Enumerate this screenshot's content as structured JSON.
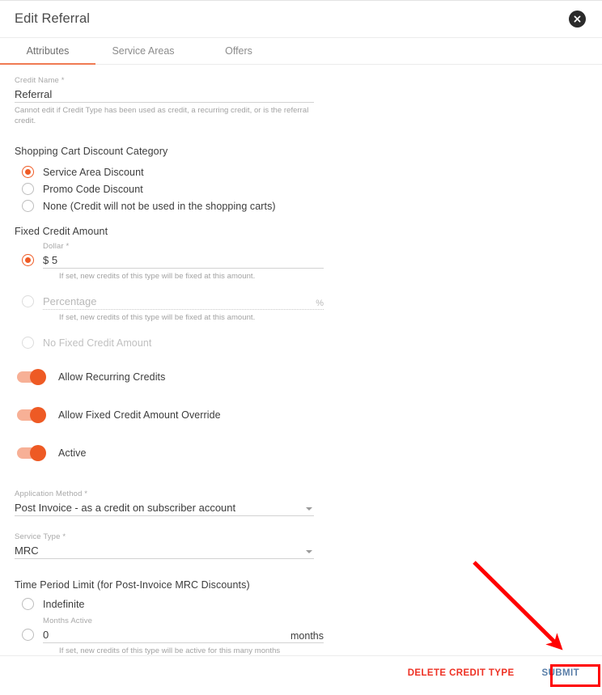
{
  "dialog": {
    "title": "Edit Referral",
    "close_icon": "close-circle-icon"
  },
  "tabs": [
    {
      "label": "Attributes",
      "active": true
    },
    {
      "label": "Service Areas",
      "active": false
    },
    {
      "label": "Offers",
      "active": false
    }
  ],
  "form": {
    "credit_name": {
      "label": "Credit Name *",
      "value": "Referral",
      "helper": "Cannot edit if Credit Type has been used as credit, a recurring credit, or is the referral credit."
    },
    "shopping_cart_discount_category": {
      "title": "Shopping Cart Discount Category",
      "options": [
        {
          "label": "Service Area Discount",
          "selected": true,
          "disabled": false
        },
        {
          "label": "Promo Code Discount",
          "selected": false,
          "disabled": false
        },
        {
          "label": "None (Credit will not be used in the shopping carts)",
          "selected": false,
          "disabled": false
        }
      ]
    },
    "fixed_credit_amount": {
      "title": "Fixed Credit Amount",
      "dollar": {
        "selected": true,
        "label": "Dollar *",
        "value": "$ 5",
        "helper": "If set, new credits of this type will be fixed at this amount."
      },
      "percentage": {
        "selected": false,
        "disabled": true,
        "placeholder": "Percentage",
        "value": "",
        "suffix": "%",
        "helper": "If set, new credits of this type will be fixed at this amount."
      },
      "none": {
        "selected": false,
        "disabled": true,
        "label": "No Fixed Credit Amount"
      }
    },
    "toggles": [
      {
        "label": "Allow Recurring Credits",
        "on": true
      },
      {
        "label": "Allow Fixed Credit Amount Override",
        "on": true
      },
      {
        "label": "Active",
        "on": true
      }
    ],
    "application_method": {
      "label": "Application Method *",
      "value": "Post Invoice - as a credit on subscriber account"
    },
    "service_type": {
      "label": "Service Type *",
      "value": "MRC"
    },
    "time_period_limit": {
      "title": "Time Period Limit (for Post-Invoice MRC Discounts)",
      "indefinite": {
        "label": "Indefinite",
        "selected": false
      },
      "months": {
        "selected": false,
        "label": "Months Active",
        "value": "0",
        "suffix": "months",
        "helper": "If set, new credits of this type will be active for this many months"
      }
    }
  },
  "footer": {
    "delete_label": "DELETE CREDIT TYPE",
    "submit_label": "SUBMIT"
  },
  "annotation": {
    "arrow_color": "#ff0000",
    "highlight_color": "#ff0000",
    "points_to": "SUBMIT"
  },
  "colors": {
    "accent": "#ef5b25",
    "toggle_track": "#f7b096",
    "tab_underline": "#ef7a52",
    "delete_text": "#ee3124",
    "submit_text": "#5a7ea8"
  }
}
